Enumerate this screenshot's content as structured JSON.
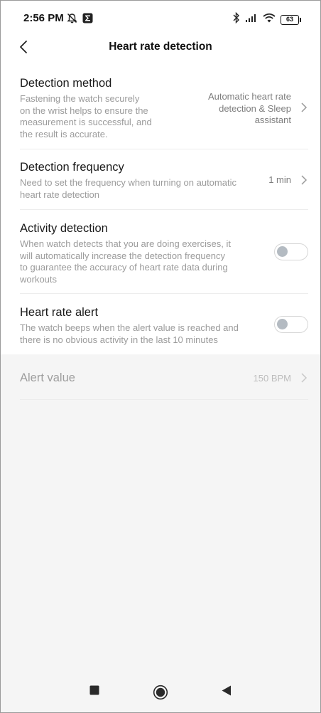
{
  "status_bar": {
    "time": "2:56 PM",
    "battery": "63",
    "icons": [
      "alarm-off-icon",
      "app-notification-icon",
      "bluetooth-icon",
      "signal-icon",
      "wifi-icon",
      "battery-icon"
    ]
  },
  "header": {
    "title": "Heart rate detection",
    "back_icon": "back-arrow-icon"
  },
  "settings": {
    "detection_method": {
      "title": "Detection method",
      "desc_lines": [
        "Fastening the watch securely",
        "on the wrist helps to ensure the",
        "measurement is successful, and",
        "the result is accurate."
      ],
      "value_lines": [
        "Automatic heart rate",
        "detection & Sleep",
        "assistant"
      ]
    },
    "detection_frequency": {
      "title": "Detection frequency",
      "desc_lines": [
        "Need to set the frequency when turning on automatic",
        "heart rate detection"
      ],
      "value": "1 min"
    },
    "activity_detection": {
      "title": "Activity detection",
      "desc_lines": [
        "When watch detects that you are doing exercises, it",
        "will automatically increase the detection frequency",
        "to guarantee the accuracy of heart rate data during",
        "workouts"
      ],
      "enabled": false
    },
    "heart_rate_alert": {
      "title": "Heart rate alert",
      "desc_lines": [
        "The watch beeps when the alert value is reached and",
        "there is no obvious activity in the last 10 minutes"
      ],
      "enabled": false
    },
    "alert_value": {
      "title": "Alert value",
      "value": "150 BPM",
      "disabled": true
    }
  },
  "nav_bar": {
    "buttons": [
      "recents-square-icon",
      "home-circle-icon",
      "back-triangle-icon"
    ]
  },
  "colors": {
    "background": "#f5f5f5",
    "card": "#ffffff",
    "title_text": "#1a1a1a",
    "desc_text": "#9b9b9b",
    "toggle_knob": "#b4bbc2"
  }
}
